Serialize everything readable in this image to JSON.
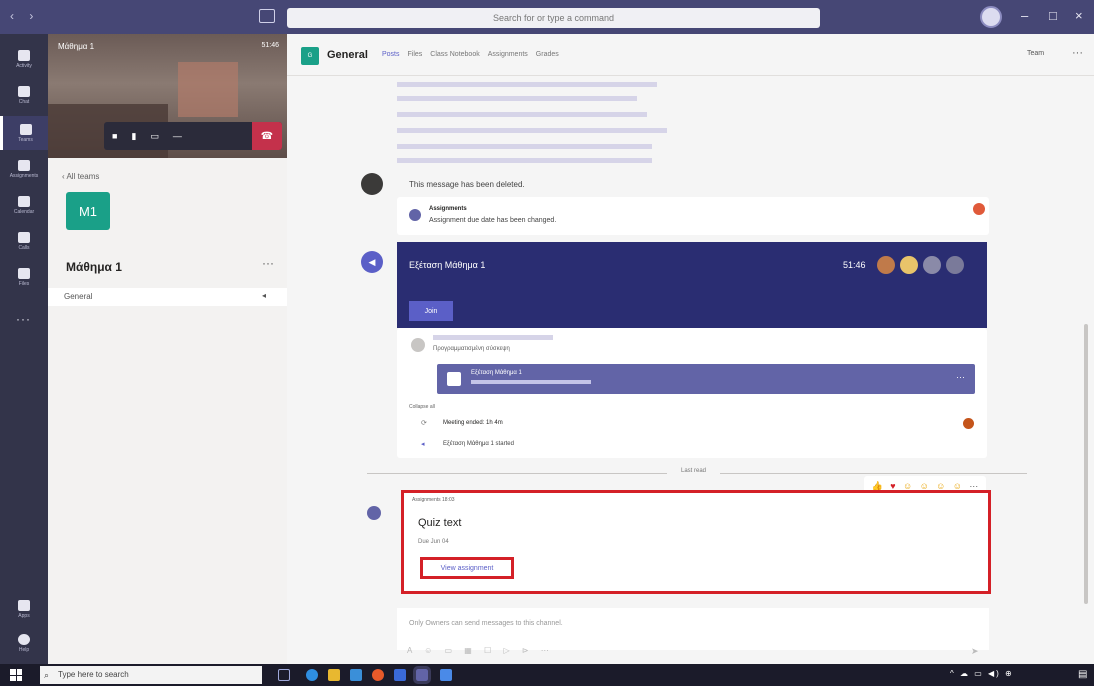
{
  "titlebar": {
    "search_placeholder": "Search for or type a command",
    "minimize": "–",
    "maximize": "□",
    "close": "×"
  },
  "rail": {
    "items": [
      {
        "label": "Activity"
      },
      {
        "label": "Chat"
      },
      {
        "label": "Teams"
      },
      {
        "label": "Assignments"
      },
      {
        "label": "Calendar"
      },
      {
        "label": "Calls"
      },
      {
        "label": "Files"
      }
    ],
    "more": "···",
    "bottom": [
      {
        "label": "Apps"
      },
      {
        "label": "Help"
      }
    ]
  },
  "leftpane": {
    "meeting_title": "Μάθημα 1",
    "timer": "51:46",
    "all_teams": "All teams",
    "team_initials": "M1",
    "team_name": "Μάθημα 1",
    "team_menu": "···",
    "channel": "General"
  },
  "channel": {
    "tile": "G",
    "name": "General",
    "tabs": [
      "Posts",
      "Files",
      "Class Notebook",
      "Assignments",
      "Grades"
    ],
    "team_button": "Team",
    "menu": "···"
  },
  "feed": {
    "deleted_msg": "This message has been deleted.",
    "assign_notice_author": "Assignments",
    "assign_notice_text": "Assignment due date has been changed.",
    "meeting_title": "Εξέταση Μάθημα 1",
    "meeting_duration": "51:46",
    "join_label": "Join",
    "reply_text": "Προγραμματισμένη σύσκεψη",
    "event_title": "Εξέταση Μάθημα 1",
    "collapse": "Collapse all",
    "ended_text": "Meeting ended: 1h 4m",
    "started_text": "Εξέταση Μάθημα 1 started",
    "last_read": "Last read"
  },
  "assignment": {
    "author": "Assignments",
    "time": "18:03",
    "title": "Quiz text",
    "due": "Due Jun 04",
    "view_button": "View assignment"
  },
  "composer": {
    "placeholder": "Only Owners can send messages to this channel."
  },
  "taskbar": {
    "search_placeholder": "Type here to search"
  },
  "colors": {
    "titlebar": "#464775",
    "rail": "#33344a",
    "accent": "#5b5fc7",
    "team_tile": "#1aa088",
    "highlight": "#d42027",
    "meeting_banner": "#2a2d72"
  }
}
